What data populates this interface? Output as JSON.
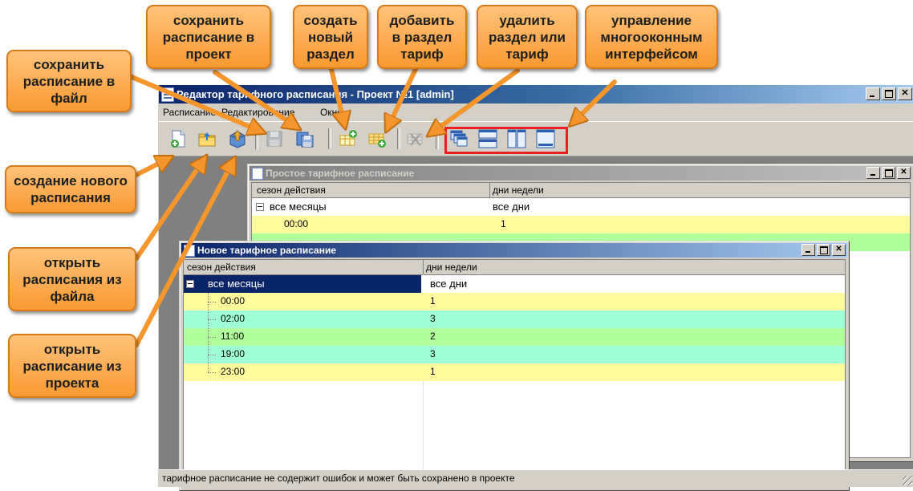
{
  "window": {
    "title": "Редактор тарифного расписания - Проект №1 [admin]"
  },
  "menu": {
    "items": [
      "Расписание",
      "Редактирование",
      "Окно"
    ]
  },
  "toolbar": {
    "buttons": [
      {
        "name": "new-schedule",
        "icon": "new-document-icon"
      },
      {
        "name": "open-from-file",
        "icon": "open-folder-icon"
      },
      {
        "name": "open-from-project",
        "icon": "open-project-icon"
      },
      {
        "name": "save-to-file",
        "icon": "save-disk-icon",
        "enabled": false
      },
      {
        "name": "save-to-project",
        "icon": "save-project-icon"
      },
      {
        "name": "create-section",
        "icon": "add-section-icon"
      },
      {
        "name": "add-tariff",
        "icon": "add-tariff-icon"
      },
      {
        "name": "delete",
        "icon": "delete-icon",
        "enabled": false
      },
      {
        "name": "cascade",
        "icon": "cascade-windows-icon"
      },
      {
        "name": "tile-horizontal",
        "icon": "tile-horizontal-icon"
      },
      {
        "name": "tile-vertical",
        "icon": "tile-vertical-icon"
      },
      {
        "name": "minimize-all",
        "icon": "minimize-all-icon"
      }
    ]
  },
  "back_window": {
    "title": "Простое тарифное расписание",
    "col1": "сезон действия",
    "col2": "дни недели",
    "rows": [
      {
        "c1": "все месяцы",
        "c2": "все дни"
      },
      {
        "c1": "00:00",
        "c2": "1"
      }
    ]
  },
  "front_window": {
    "title": "Новое тарифное расписание",
    "col1": "сезон действия",
    "col2": "дни недели",
    "root": {
      "c1": "все месяцы",
      "c2": "все дни"
    },
    "rows": [
      {
        "c1": "00:00",
        "c2": "1",
        "color": "yellow"
      },
      {
        "c1": "02:00",
        "c2": "3",
        "color": "aqua"
      },
      {
        "c1": "11:00",
        "c2": "2",
        "color": "green"
      },
      {
        "c1": "19:00",
        "c2": "3",
        "color": "aqua"
      },
      {
        "c1": "23:00",
        "c2": "1",
        "color": "yellow"
      }
    ]
  },
  "status": {
    "text": "тарифное расписание не содержит ошибок и может быть сохранено в проекте"
  },
  "callouts": {
    "save_file": "сохранить\nрасписание в\nфайл",
    "save_project": "сохранить\nрасписание в\nпроект",
    "new_section": "создать\nновый\nраздел",
    "add_tariff": "добавить\nв раздел\nтариф",
    "delete": "удалить\nраздел или\nтариф",
    "mdi": "управление\nмногооконным\nинтерфейсом",
    "new_schedule": "создание нового\nрасписания",
    "open_file": "открыть\nрасписания из\nфайла",
    "open_project": "открыть\nрасписание из\nпроекта"
  },
  "colors": {
    "callout": "#f89a32",
    "highlight": "#e82020",
    "row_yellow": "#fffc9e",
    "row_aqua": "#9fffd6",
    "row_green": "#b0ff9a"
  }
}
